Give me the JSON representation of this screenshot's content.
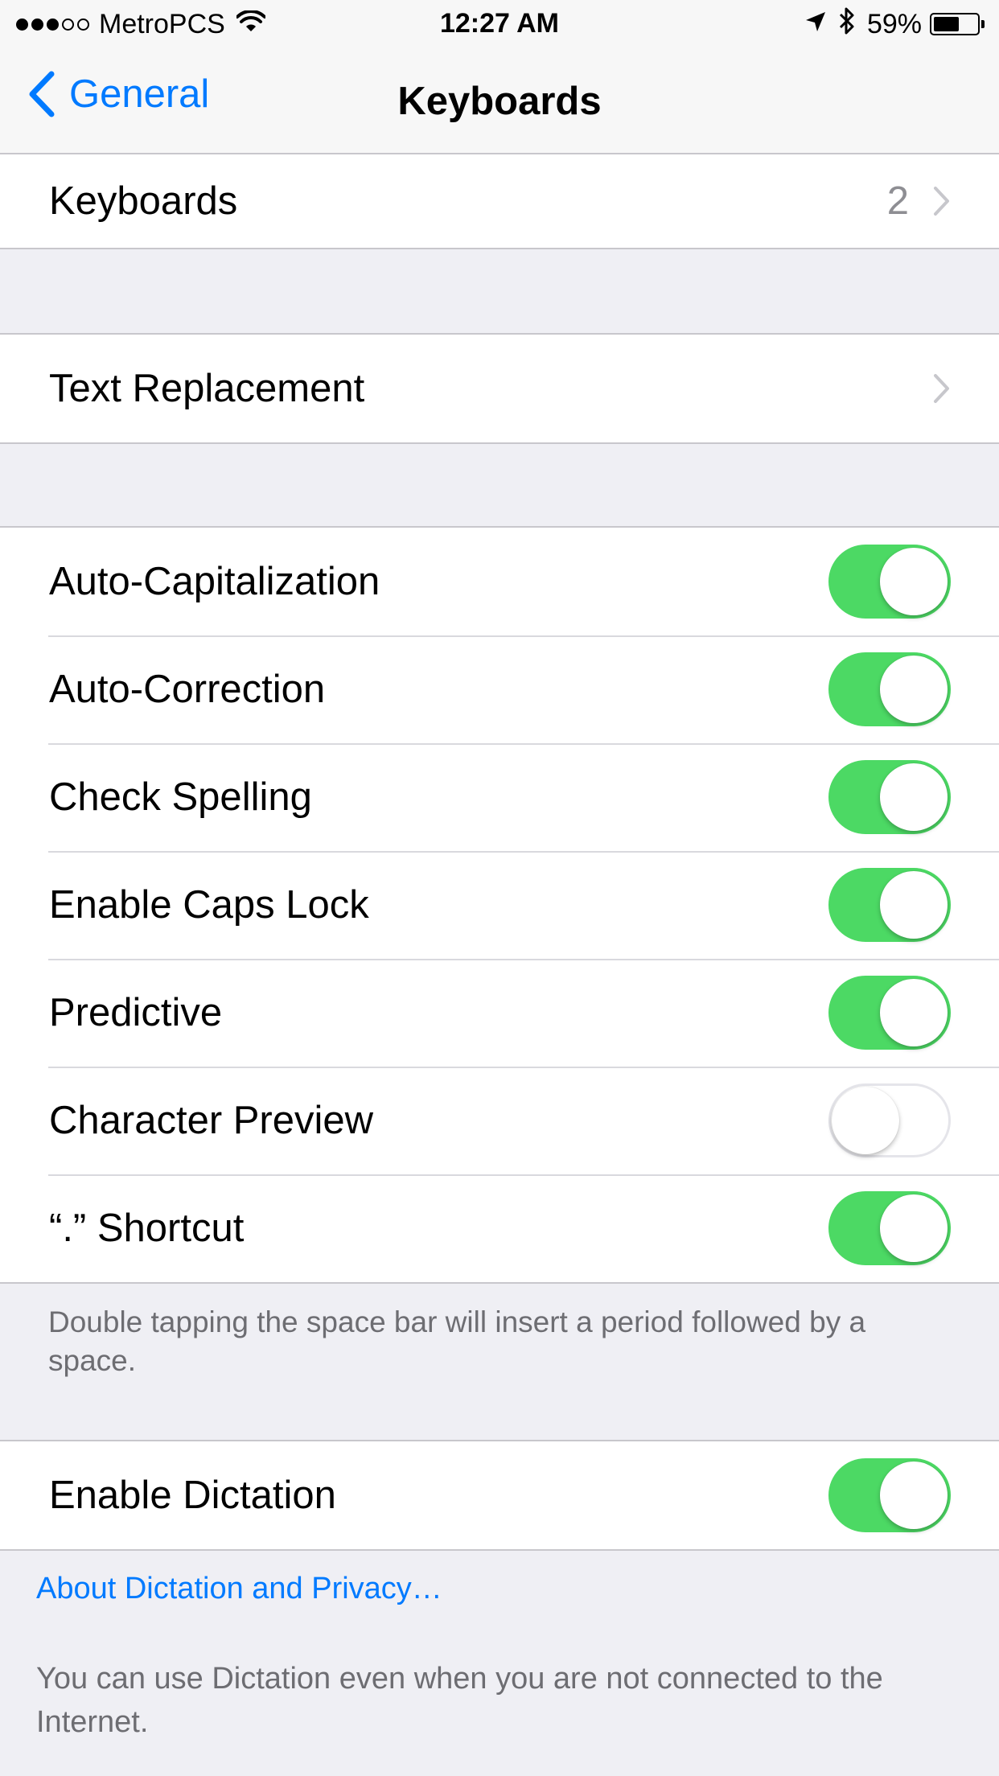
{
  "status_bar": {
    "carrier": "MetroPCS",
    "signal_bars_filled": 3,
    "signal_bars_total": 5,
    "time": "12:27 AM",
    "battery_percent": "59%",
    "battery_level": 0.59
  },
  "nav": {
    "back_label": "General",
    "title": "Keyboards"
  },
  "keyboards_row": {
    "label": "Keyboards",
    "value": "2"
  },
  "text_replacement_row": {
    "label": "Text Replacement"
  },
  "settings": [
    {
      "label": "Auto-Capitalization",
      "on": true
    },
    {
      "label": "Auto-Correction",
      "on": true
    },
    {
      "label": "Check Spelling",
      "on": true
    },
    {
      "label": "Enable Caps Lock",
      "on": true
    },
    {
      "label": "Predictive",
      "on": true
    },
    {
      "label": "Character Preview",
      "on": false
    },
    {
      "label": "“.” Shortcut",
      "on": true
    }
  ],
  "shortcut_footer": "Double tapping the space bar will insert a period followed by a space.",
  "dictation": {
    "label": "Enable Dictation",
    "on": true,
    "privacy_link": "About Dictation and Privacy…",
    "footer": "You can use Dictation even when you are not connected to the Internet."
  },
  "colors": {
    "accent": "#007AFF",
    "switch_on": "#4CD964",
    "background": "#EFEFF4"
  }
}
